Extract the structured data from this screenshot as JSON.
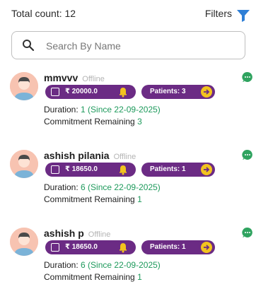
{
  "header": {
    "total_count": "Total count: 12",
    "filters_label": "Filters"
  },
  "search": {
    "placeholder": "Search By Name"
  },
  "colors": {
    "chip_purple": "#6b2b84",
    "accent_yellow": "#f2c31e",
    "green": "#1e9a5c",
    "filter_blue": "#2f7fd6"
  },
  "cards": [
    {
      "name": "mmvvv",
      "status": "Offline",
      "amount": "₹ 20000.0",
      "patients": "Patients: 3",
      "duration_label": "Duration:",
      "duration_value": "1 (Since 22-09-2025)",
      "commitment_label": "Commitment Remaining",
      "commitment_value": "3"
    },
    {
      "name": "ashish pilania",
      "status": "Offline",
      "amount": "₹ 18650.0",
      "patients": "Patients: 1",
      "duration_label": "Duration:",
      "duration_value": "6 (Since 22-09-2025)",
      "commitment_label": "Commitment Remaining",
      "commitment_value": "1"
    },
    {
      "name": "ashish p",
      "status": "Offline",
      "amount": "₹ 18650.0",
      "patients": "Patients: 1",
      "duration_label": "Duration:",
      "duration_value": "6 (Since 22-09-2025)",
      "commitment_label": "Commitment Remaining",
      "commitment_value": "1"
    }
  ]
}
